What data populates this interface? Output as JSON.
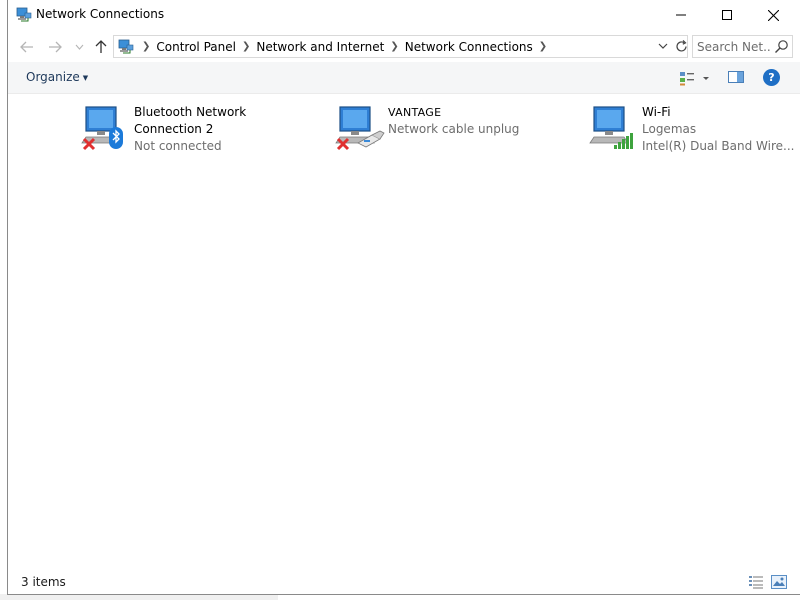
{
  "window": {
    "title": "Network Connections",
    "controls": {
      "minimize": "—",
      "maximize": "☐",
      "close": "✕"
    }
  },
  "address": {
    "breadcrumbs": [
      "Control Panel",
      "Network and Internet",
      "Network Connections"
    ],
    "search_placeholder": "Search Net..."
  },
  "toolbar": {
    "organize_label": "Organize",
    "help_label": "?"
  },
  "connections": [
    {
      "name_line1": "Bluetooth Network",
      "name_line2": "Connection 2",
      "status": "Not connected",
      "device": "",
      "icon": "bluetooth-network-icon",
      "disconnected": true
    },
    {
      "name_line1": "VANTAGE",
      "name_line2": "",
      "status": "Network cable unplug",
      "device": "",
      "icon": "ethernet-network-icon",
      "disconnected": true
    },
    {
      "name_line1": "Wi-Fi",
      "name_line2": "",
      "status": "Logemas",
      "device": "Intel(R) Dual Band Wire...",
      "icon": "wifi-network-icon",
      "disconnected": false
    }
  ],
  "status": {
    "items_count": "3 items"
  },
  "colors": {
    "accent": "#1f6fc5",
    "error": "#e03030",
    "wifi_signal": "#3ea33e"
  }
}
